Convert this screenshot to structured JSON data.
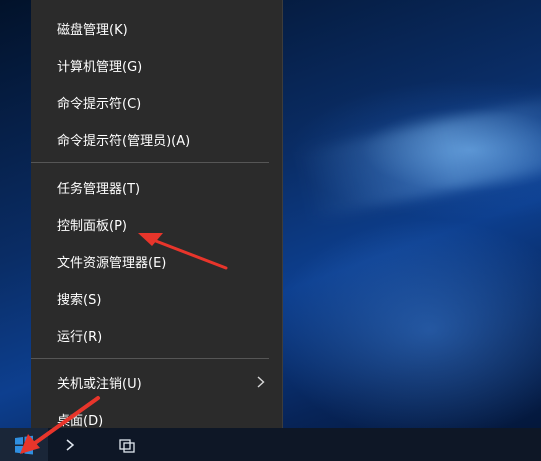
{
  "menu": {
    "items": [
      {
        "label": "磁盘管理(K)"
      },
      {
        "label": "计算机管理(G)"
      },
      {
        "label": "命令提示符(C)"
      },
      {
        "label": "命令提示符(管理员)(A)"
      },
      {
        "label": "任务管理器(T)"
      },
      {
        "label": "控制面板(P)"
      },
      {
        "label": "文件资源管理器(E)"
      },
      {
        "label": "搜索(S)"
      },
      {
        "label": "运行(R)"
      },
      {
        "label": "关机或注销(U)"
      },
      {
        "label": "桌面(D)"
      }
    ]
  },
  "colors": {
    "menu_bg": "#2b2b2b",
    "menu_text": "#ffffff",
    "annotation_arrow": "#e8352b",
    "start_logo": "#2f8fe0"
  },
  "icons": {
    "start": "windows-logo-icon",
    "submenu": "chevron-right-icon",
    "task_view": "task-view-icon",
    "search": "chevron-icon"
  }
}
